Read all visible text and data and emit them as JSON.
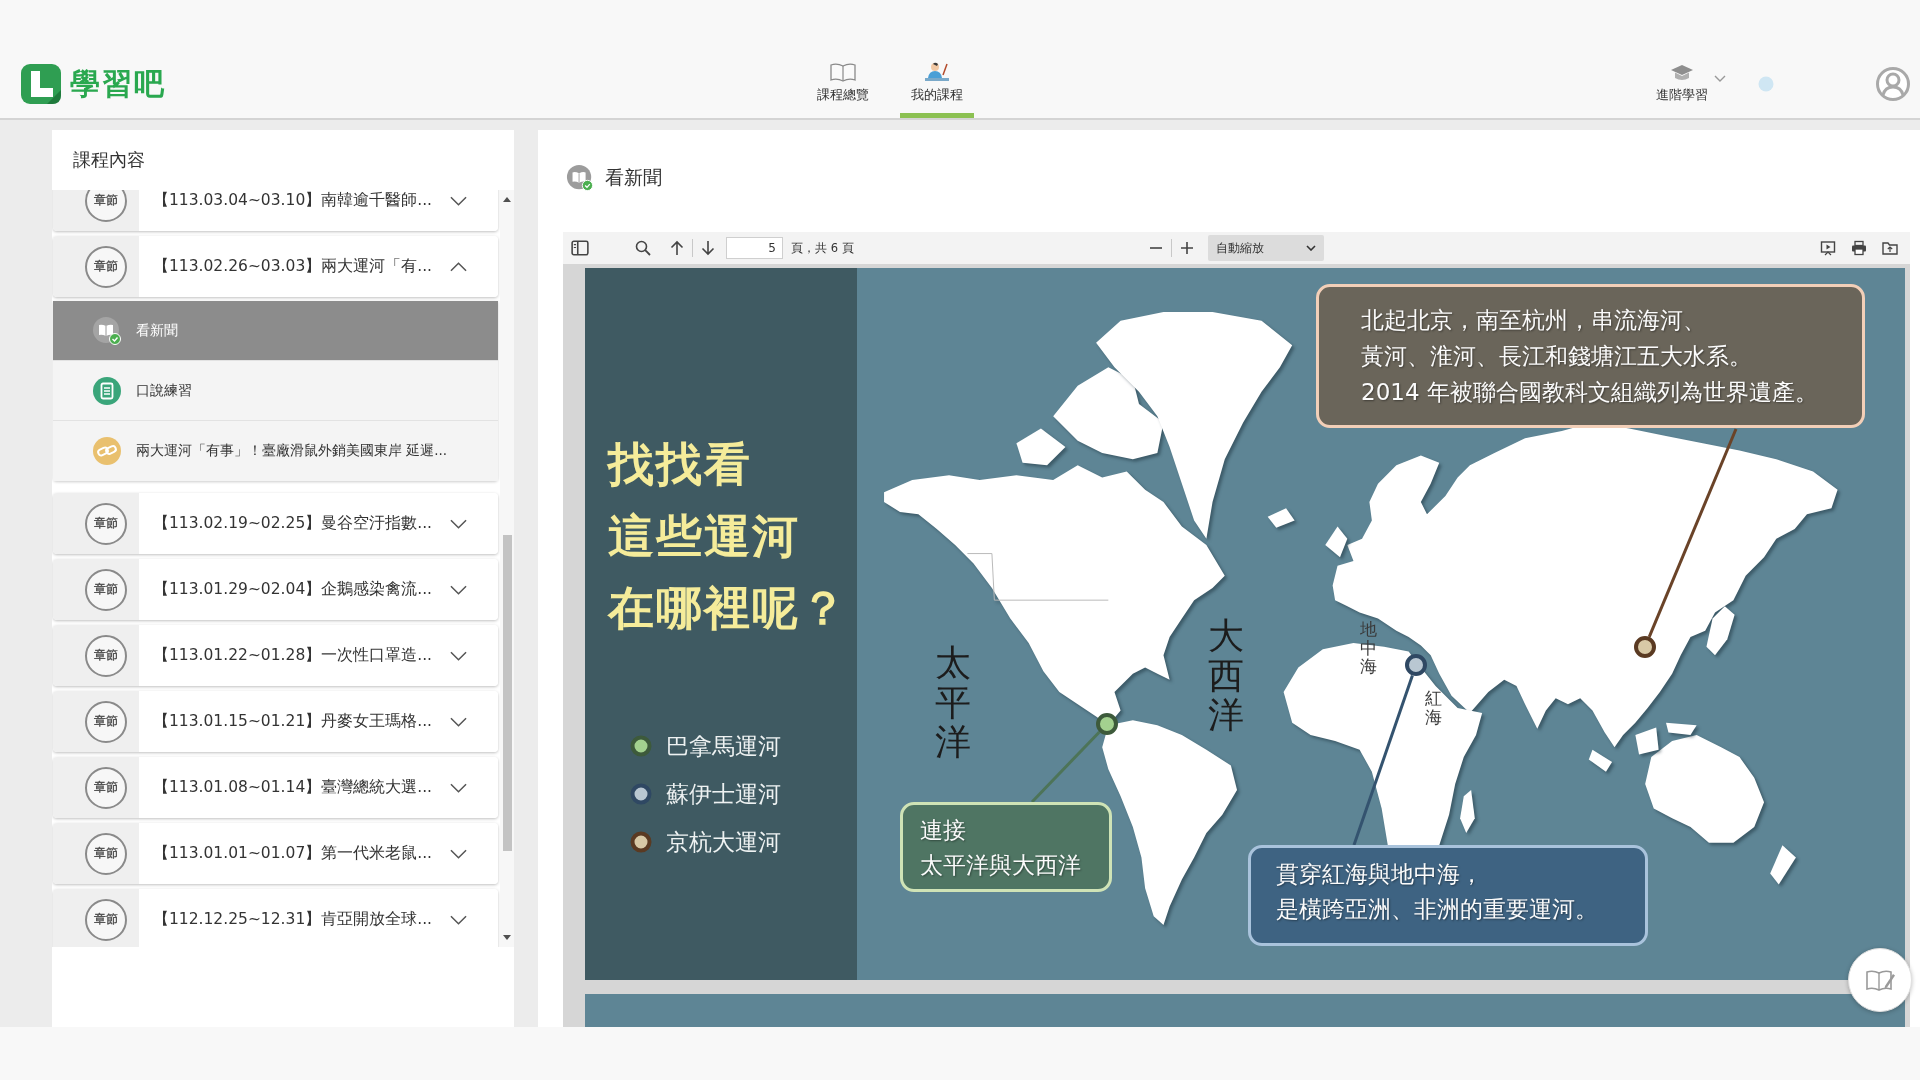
{
  "header": {
    "logo": "學習吧",
    "nav": [
      {
        "label": "課程總覽",
        "selected": false
      },
      {
        "label": "我的課程",
        "selected": true
      }
    ],
    "menu": {
      "label": "進階學習"
    }
  },
  "sidebar": {
    "title": "課程內容",
    "chapters": [
      {
        "badge": "章節",
        "title": "【113.03.04~03.10】南韓逾千醫師...",
        "expanded": false
      },
      {
        "badge": "章節",
        "title": "【113.02.26~03.03】兩大運河「有...",
        "expanded": true,
        "children": [
          {
            "kind": "news",
            "label": "看新聞",
            "selected": true
          },
          {
            "kind": "practice",
            "label": "口說練習",
            "selected": false
          },
          {
            "kind": "link",
            "label": "兩大運河「有事」！臺廠滑鼠外銷美國東岸 延遲...",
            "selected": false
          }
        ]
      },
      {
        "badge": "章節",
        "title": "【113.02.19~02.25】曼谷空汙指數...",
        "expanded": false
      },
      {
        "badge": "章節",
        "title": "【113.01.29~02.04】企鵝感染禽流...",
        "expanded": false
      },
      {
        "badge": "章節",
        "title": "【113.01.22~01.28】一次性口罩造...",
        "expanded": false
      },
      {
        "badge": "章節",
        "title": "【113.01.15~01.21】丹麥女王瑪格...",
        "expanded": false
      },
      {
        "badge": "章節",
        "title": "【113.01.08~01.14】臺灣總統大選...",
        "expanded": false
      },
      {
        "badge": "章節",
        "title": "【113.01.01~01.07】第一代米老鼠...",
        "expanded": false
      },
      {
        "badge": "章節",
        "title": "【112.12.25~12.31】肯亞開放全球...",
        "expanded": false
      }
    ]
  },
  "content": {
    "title": "看新聞",
    "toolbar": {
      "page": "5",
      "page_count": "頁，共 6 頁",
      "zoom": "自動縮放"
    },
    "slide": {
      "heading": [
        "找找看",
        "這些運河",
        "在哪裡呢？"
      ],
      "legend": [
        {
          "label": "巴拿馬運河",
          "color": "#a3d18f"
        },
        {
          "label": "蘇伊士運河",
          "color": "#b9c7d2"
        },
        {
          "label": "京杭大運河",
          "color": "#d8c9a6"
        }
      ],
      "map_labels": [
        {
          "kind": "ocean",
          "text": "太平洋"
        },
        {
          "kind": "ocean",
          "text": "大西洋"
        },
        {
          "kind": "sea",
          "text": "地中海"
        },
        {
          "kind": "sea",
          "text": "紅海"
        }
      ],
      "callouts": [
        {
          "lines": [
            "連接",
            "太平洋與大西洋"
          ]
        },
        {
          "lines": [
            "貫穿紅海與地中海，",
            "是橫跨亞洲、非洲的重要運河。"
          ]
        },
        {
          "lines": [
            "北起北京，南至杭州，串流海河、",
            "黃河、淮河、長江和錢塘江五大水系。",
            "2014 年被聯合國教科文組織列為世界遺產。"
          ]
        }
      ]
    }
  }
}
